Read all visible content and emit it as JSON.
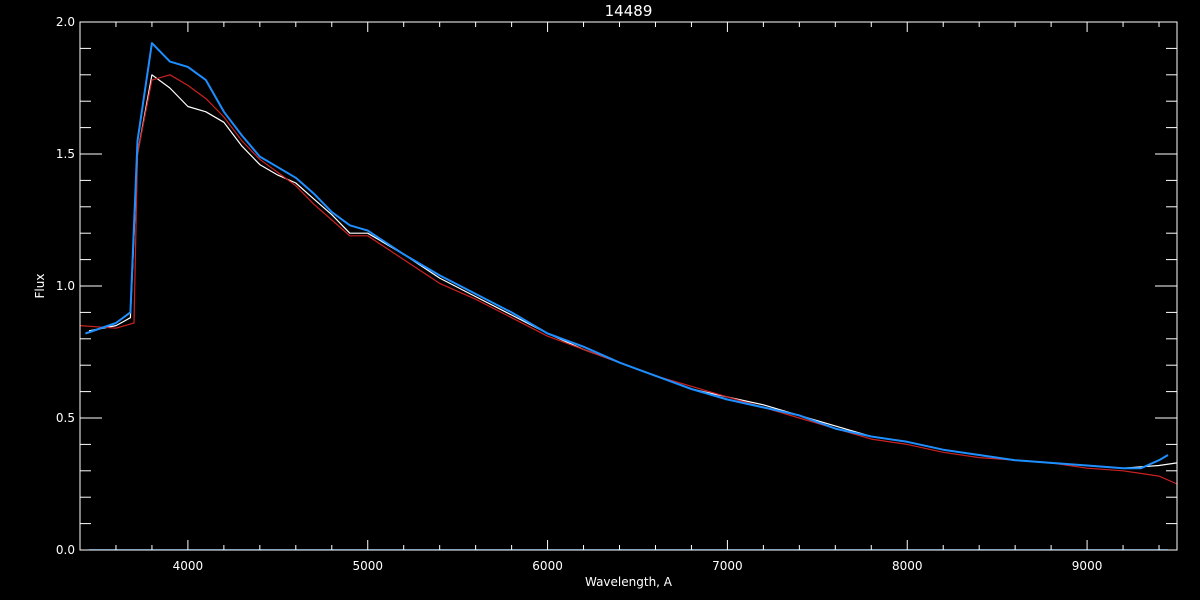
{
  "chart_data": {
    "type": "line",
    "title": "14489",
    "xlabel": "Wavelength, A",
    "ylabel": "Flux",
    "xlim": [
      3400,
      9500
    ],
    "ylim": [
      0.0,
      2.0
    ],
    "x_ticks": [
      4000,
      5000,
      6000,
      7000,
      8000,
      9000
    ],
    "x_tick_labels": [
      "4000",
      "5000",
      "6000",
      "7000",
      "8000",
      "9000"
    ],
    "y_ticks": [
      0.0,
      0.5,
      1.0,
      1.5,
      2.0
    ],
    "y_tick_labels": [
      "0.0",
      "0.5",
      "1.0",
      "1.5",
      "2.0"
    ],
    "grid": false,
    "colors": {
      "background": "#000000",
      "axes": "#ffffff",
      "observed": "#ffffff",
      "model": "#cc2222",
      "overlay": "#1e8fff"
    },
    "series": [
      {
        "color": "#ffffff",
        "x": [
          3450,
          3600,
          3680,
          3720,
          3800,
          3900,
          4000,
          4100,
          4200,
          4300,
          4400,
          4500,
          4600,
          4700,
          4800,
          4900,
          5000,
          5200,
          5400,
          5600,
          5800,
          6000,
          6200,
          6400,
          6600,
          6800,
          7000,
          7200,
          7400,
          7600,
          7800,
          8000,
          8200,
          8400,
          8600,
          8800,
          9000,
          9200,
          9400,
          9500
        ],
        "y": [
          0.83,
          0.85,
          0.88,
          1.5,
          1.8,
          1.75,
          1.68,
          1.66,
          1.62,
          1.53,
          1.46,
          1.42,
          1.39,
          1.33,
          1.27,
          1.2,
          1.2,
          1.12,
          1.03,
          0.96,
          0.89,
          0.82,
          0.76,
          0.71,
          0.66,
          0.61,
          0.58,
          0.55,
          0.51,
          0.47,
          0.43,
          0.41,
          0.38,
          0.36,
          0.34,
          0.33,
          0.32,
          0.31,
          0.32,
          0.33
        ]
      },
      {
        "color": "#cc2222",
        "x": [
          3400,
          3600,
          3700,
          3720,
          3800,
          3900,
          4000,
          4100,
          4200,
          4300,
          4400,
          4500,
          4600,
          4700,
          4800,
          4900,
          5000,
          5200,
          5400,
          5600,
          5800,
          6000,
          6200,
          6400,
          6600,
          6800,
          7000,
          7200,
          7400,
          7600,
          7800,
          8000,
          8200,
          8400,
          8600,
          8800,
          9000,
          9200,
          9400,
          9500
        ],
        "y": [
          0.85,
          0.84,
          0.86,
          1.5,
          1.78,
          1.8,
          1.76,
          1.71,
          1.64,
          1.55,
          1.48,
          1.43,
          1.38,
          1.31,
          1.25,
          1.19,
          1.19,
          1.1,
          1.01,
          0.95,
          0.88,
          0.81,
          0.76,
          0.71,
          0.66,
          0.62,
          0.58,
          0.54,
          0.5,
          0.46,
          0.42,
          0.4,
          0.37,
          0.35,
          0.34,
          0.33,
          0.31,
          0.3,
          0.28,
          0.25
        ]
      },
      {
        "color": "#1e8fff",
        "x": [
          3430,
          3600,
          3680,
          3720,
          3800,
          3900,
          4000,
          4100,
          4200,
          4300,
          4400,
          4500,
          4600,
          4700,
          4800,
          4900,
          5000,
          5200,
          5400,
          5600,
          5800,
          6000,
          6200,
          6400,
          6600,
          6800,
          7000,
          7200,
          7400,
          7600,
          7800,
          8000,
          8200,
          8400,
          8600,
          8800,
          9000,
          9200,
          9300,
          9400,
          9450
        ],
        "y": [
          0.82,
          0.86,
          0.9,
          1.55,
          1.92,
          1.85,
          1.83,
          1.78,
          1.66,
          1.57,
          1.49,
          1.45,
          1.41,
          1.35,
          1.28,
          1.23,
          1.21,
          1.12,
          1.04,
          0.97,
          0.9,
          0.82,
          0.77,
          0.71,
          0.66,
          0.61,
          0.57,
          0.54,
          0.51,
          0.46,
          0.43,
          0.41,
          0.38,
          0.36,
          0.34,
          0.33,
          0.32,
          0.31,
          0.31,
          0.34,
          0.36
        ]
      }
    ]
  }
}
